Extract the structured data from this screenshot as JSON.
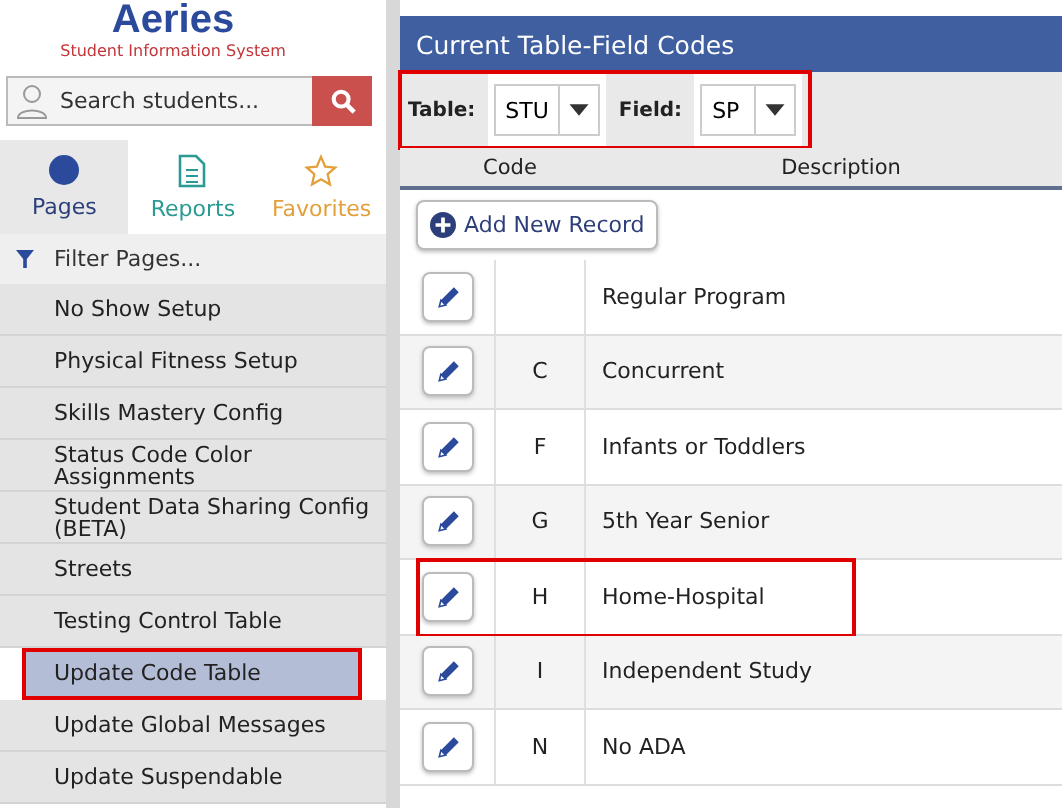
{
  "sidebar": {
    "logo": "Aeries",
    "subtitle": "Student Information System",
    "search": {
      "placeholder": "Search students..."
    },
    "tabs": [
      {
        "label": "Pages",
        "kind": "dot",
        "selected": true
      },
      {
        "label": "Reports",
        "kind": "doc",
        "selected": false
      },
      {
        "label": "Favorites",
        "kind": "star",
        "selected": false
      }
    ],
    "filter": {
      "placeholder": "Filter Pages..."
    },
    "items": [
      {
        "label": "No Show Setup",
        "selected": false,
        "outlined": false
      },
      {
        "label": "Physical Fitness Setup",
        "selected": false,
        "outlined": false
      },
      {
        "label": "Skills Mastery Config",
        "selected": false,
        "outlined": false
      },
      {
        "label": "Status Code Color Assignments",
        "selected": false,
        "outlined": false
      },
      {
        "label": "Student Data Sharing Config (BETA)",
        "selected": false,
        "outlined": false
      },
      {
        "label": "Streets",
        "selected": false,
        "outlined": false
      },
      {
        "label": "Testing Control Table",
        "selected": false,
        "outlined": false
      },
      {
        "label": "Update Code Table",
        "selected": true,
        "outlined": true
      },
      {
        "label": "Update Global Messages",
        "selected": false,
        "outlined": false
      },
      {
        "label": "Update Suspendable",
        "selected": false,
        "outlined": false
      }
    ]
  },
  "panel": {
    "title": "Current Table-Field Codes",
    "filters_outlined": true,
    "filters": [
      {
        "label": "Table:",
        "value": "STU"
      },
      {
        "label": "Field:",
        "value": "SP"
      }
    ],
    "columns": [
      "Code",
      "Description"
    ],
    "add_button": "Add New Record",
    "rows": [
      {
        "code": "",
        "description": "Regular Program",
        "outlined": false
      },
      {
        "code": "C",
        "description": "Concurrent",
        "outlined": false
      },
      {
        "code": "F",
        "description": "Infants or Toddlers",
        "outlined": false
      },
      {
        "code": "G",
        "description": "5th Year Senior",
        "outlined": false
      },
      {
        "code": "H",
        "description": "Home-Hospital",
        "outlined": true
      },
      {
        "code": "I",
        "description": "Independent Study",
        "outlined": false
      },
      {
        "code": "N",
        "description": "No ADA",
        "outlined": false
      }
    ]
  }
}
